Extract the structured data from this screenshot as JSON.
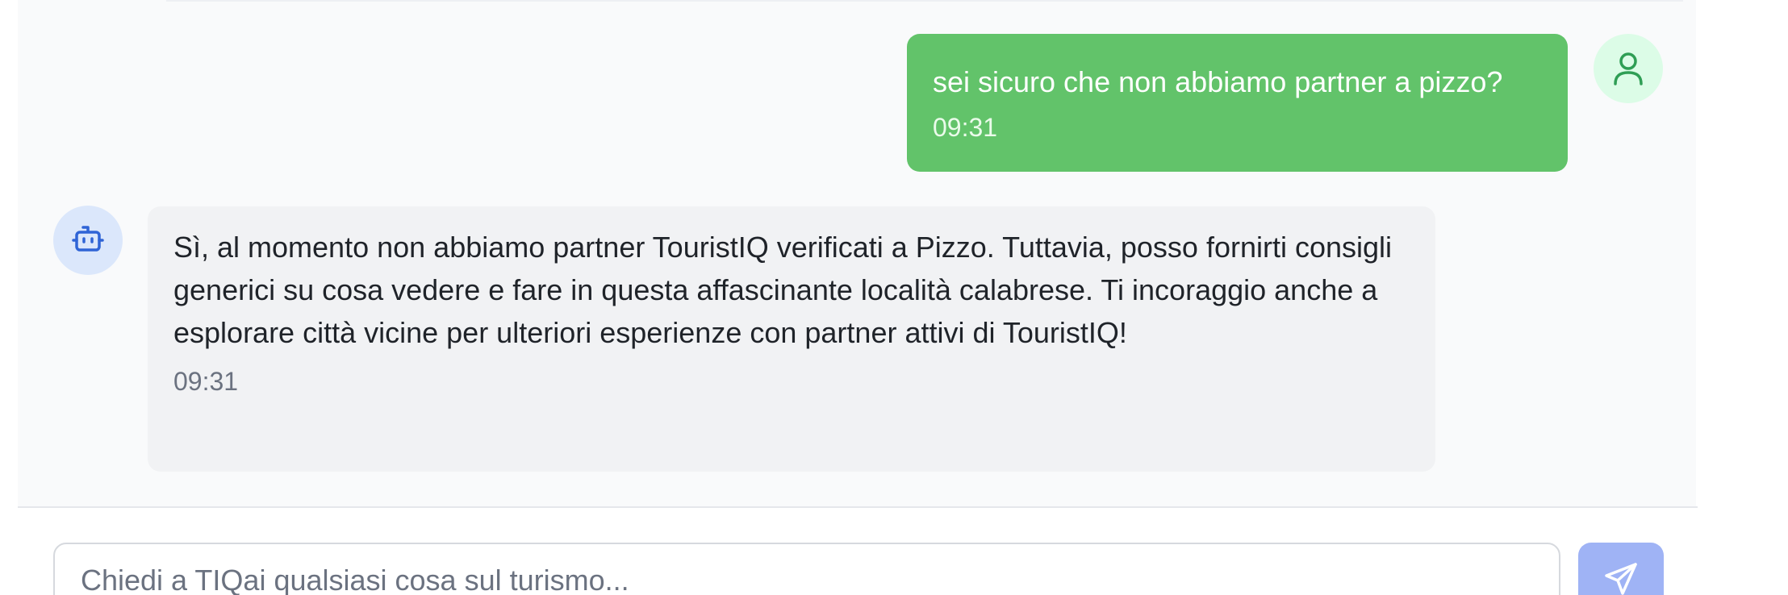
{
  "messages": [
    {
      "role": "user",
      "text": "sei sicuro che non abbiamo partner a pizzo?",
      "time": "09:31",
      "avatar_icon": "user-icon"
    },
    {
      "role": "assistant",
      "text": "Sì, al momento non abbiamo partner TouristIQ verificati a Pizzo. Tuttavia, posso fornirti consigli generici su cosa vedere e fare in questa affascinante località calabrese. Ti incoraggio anche a esplorare città vicine per ulteriori esperienze con partner attivi di TouristIQ!",
      "time": "09:31",
      "avatar_icon": "bot-icon"
    }
  ],
  "composer": {
    "placeholder": "Chiedi a TIQai qualsiasi cosa sul turismo...",
    "value": "",
    "send_icon": "send-icon"
  },
  "colors": {
    "user_bubble": "#62c36a",
    "user_avatar_bg": "#dcfce7",
    "user_icon": "#2f9e55",
    "bot_bubble": "#f1f2f4",
    "bot_avatar_bg": "#dbe7fb",
    "bot_icon": "#2f64d6",
    "send_button": "#9fb3f5"
  }
}
